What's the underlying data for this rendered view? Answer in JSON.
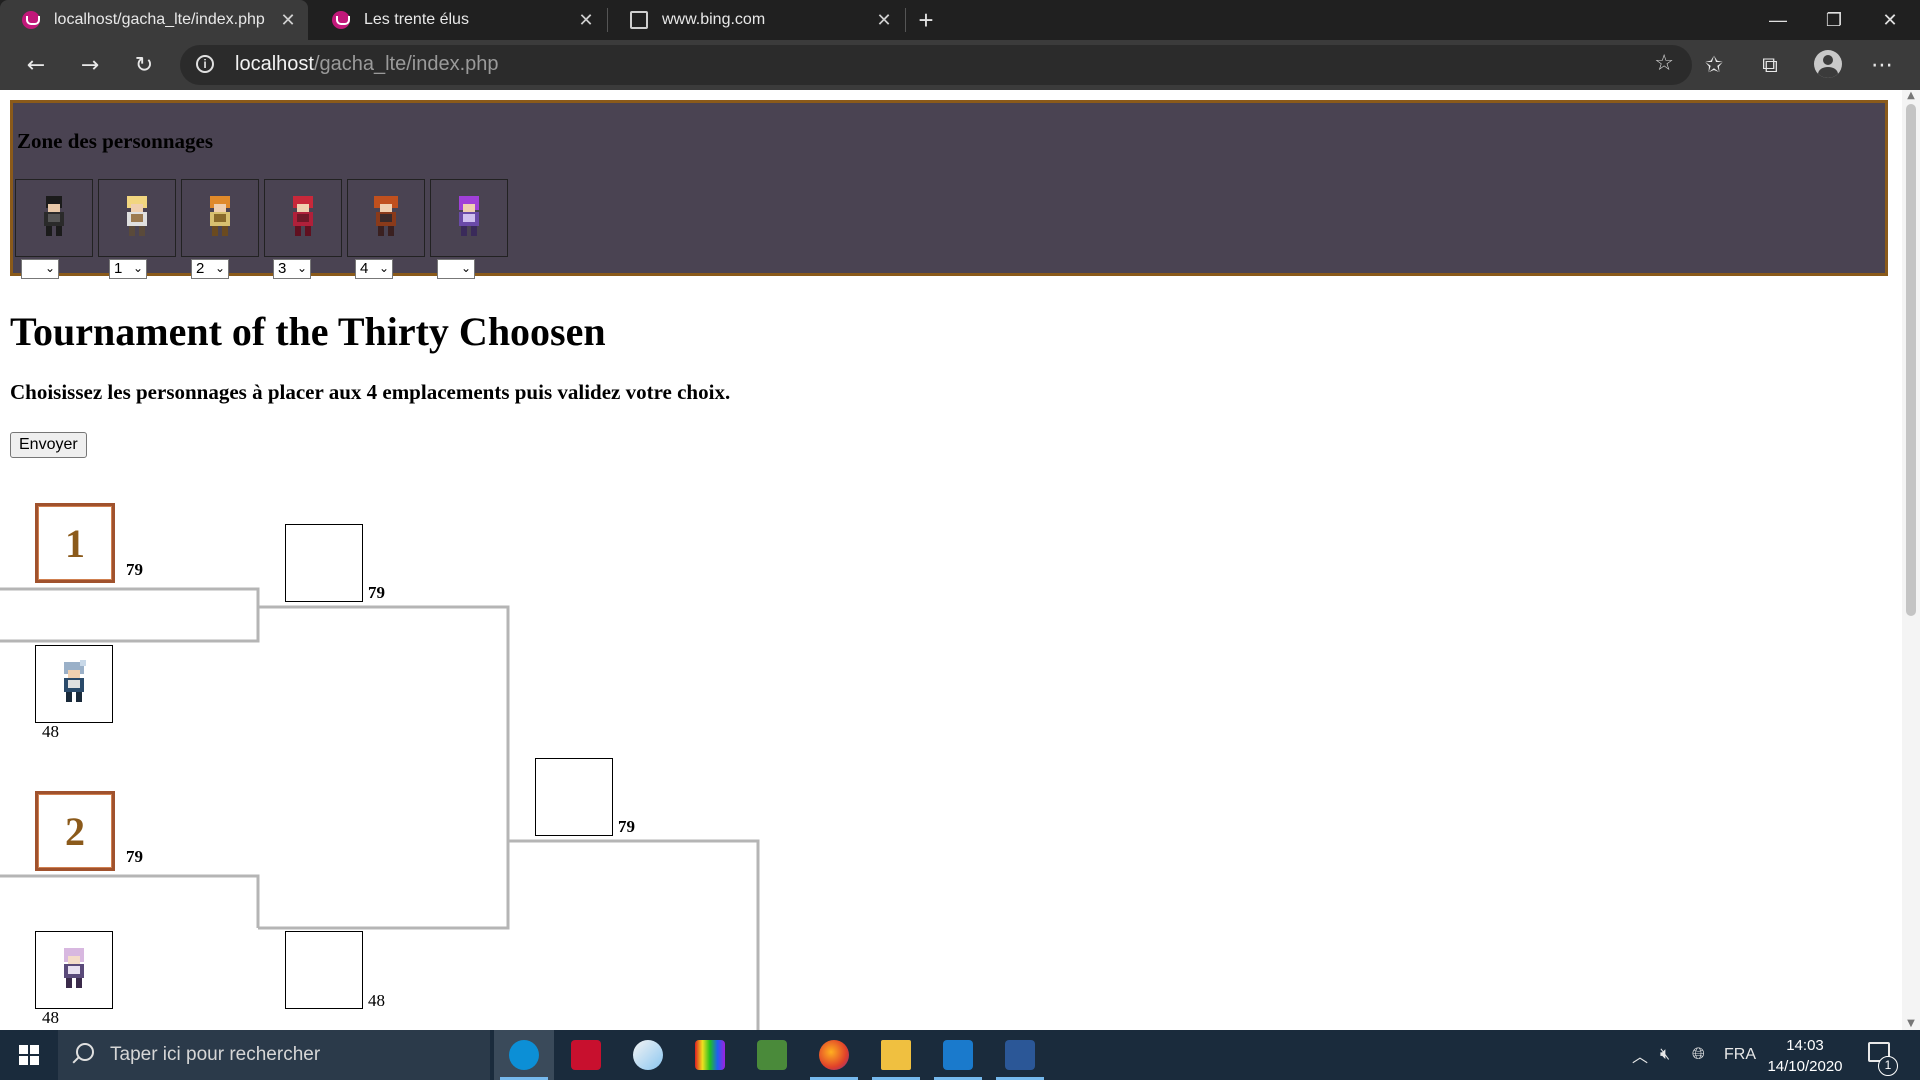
{
  "browser": {
    "tabs": [
      {
        "title": "localhost/gacha_lte/index.php"
      },
      {
        "title": "Les trente élus"
      },
      {
        "title": "www.bing.com"
      }
    ],
    "address": {
      "host": "localhost",
      "path": "/gacha_lte/index.php"
    }
  },
  "page": {
    "zone_title": "Zone des personnages",
    "slots": [
      {
        "value": ""
      },
      {
        "value": "1"
      },
      {
        "value": "2"
      },
      {
        "value": "3"
      },
      {
        "value": "4"
      },
      {
        "value": ""
      }
    ],
    "heading": "Tournament of the Thirty Choosen",
    "instruction": "Choisissez les personnages à placer aux 4 emplacements puis validez votre choix.",
    "submit_label": "Envoyer",
    "bracket": {
      "seeds": [
        {
          "label": "1",
          "score": "79"
        },
        {
          "label": "2",
          "score": "79"
        }
      ],
      "opponents": [
        {
          "score": "48"
        },
        {
          "score": "48"
        }
      ],
      "round2": [
        {
          "score": "79"
        },
        {
          "score": "48"
        }
      ],
      "round3": [
        {
          "score": "79"
        }
      ]
    }
  },
  "taskbar": {
    "search_placeholder": "Taper ici pour rechercher",
    "language": "FRA",
    "time": "14:03",
    "date": "14/10/2020",
    "notification_count": "1"
  }
}
